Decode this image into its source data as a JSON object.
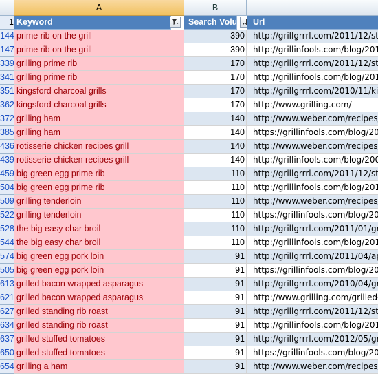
{
  "columns": [
    {
      "letter": "A",
      "selected": true
    },
    {
      "letter": "B",
      "selected": false
    }
  ],
  "header_row": {
    "number": "1",
    "keyword": "Keyword",
    "search_volume": "Search Volum",
    "url": "Url",
    "keyword_filter_icon": "filter-funnel-icon",
    "volume_sort_icon": "sort-descending-icon"
  },
  "colors": {
    "highlight_fill": "#ffc7ce",
    "highlight_text": "#9c0006",
    "header_fill": "#4f81bd",
    "band_fill": "#dce6f1",
    "selected_column_header": "#f1c15f"
  },
  "rows": [
    {
      "num": "144",
      "keyword": "prime rib on the grill",
      "volume": "390",
      "url": "http://grillgrrrl.com/2011/12/sta"
    },
    {
      "num": "147",
      "keyword": "prime rib on the grill",
      "volume": "390",
      "url": "http://grillinfools.com/blog/2010"
    },
    {
      "num": "339",
      "keyword": "grilling prime rib",
      "volume": "170",
      "url": "http://grillgrrrl.com/2011/12/sta"
    },
    {
      "num": "341",
      "keyword": "grilling prime rib",
      "volume": "170",
      "url": "http://grillinfools.com/blog/2010"
    },
    {
      "num": "351",
      "keyword": "kingsford charcoal grills",
      "volume": "170",
      "url": "http://grillgrrrl.com/2010/11/kin"
    },
    {
      "num": "362",
      "keyword": "kingsford charcoal grills",
      "volume": "170",
      "url": "http://www.grilling.com/"
    },
    {
      "num": "372",
      "keyword": "grilling ham",
      "volume": "140",
      "url": "http://www.weber.com/recipes/p"
    },
    {
      "num": "385",
      "keyword": "grilling ham",
      "volume": "140",
      "url": "https://grillinfools.com/blog/201"
    },
    {
      "num": "436",
      "keyword": "rotisserie chicken recipes grill",
      "volume": "140",
      "url": "http://www.weber.com/recipes/p"
    },
    {
      "num": "439",
      "keyword": "rotisserie chicken recipes grill",
      "volume": "140",
      "url": "http://grillinfools.com/blog/2009"
    },
    {
      "num": "459",
      "keyword": "big green egg prime rib",
      "volume": "110",
      "url": "http://grillgrrrl.com/2011/12/sta"
    },
    {
      "num": "504",
      "keyword": "big green egg prime rib",
      "volume": "110",
      "url": "http://grillinfools.com/blog/2010"
    },
    {
      "num": "509",
      "keyword": "grilling tenderloin",
      "volume": "110",
      "url": "http://www.weber.com/recipes/be"
    },
    {
      "num": "522",
      "keyword": "grilling tenderloin",
      "volume": "110",
      "url": "https://grillinfools.com/blog/201"
    },
    {
      "num": "528",
      "keyword": "the big easy char broil",
      "volume": "110",
      "url": "http://grillgrrrl.com/2011/01/gri"
    },
    {
      "num": "544",
      "keyword": "the big easy char broil",
      "volume": "110",
      "url": "http://grillinfools.com/blog/2010"
    },
    {
      "num": "574",
      "keyword": "big green egg pork loin",
      "volume": "91",
      "url": "http://grillgrrrl.com/2011/04/apr"
    },
    {
      "num": "505",
      "keyword": "big green egg pork loin",
      "volume": "91",
      "url": "https://grillinfools.com/blog/2011"
    },
    {
      "num": "613",
      "keyword": "grilled bacon wrapped asparagus",
      "volume": "91",
      "url": "http://grillgrrrl.com/2010/04/gri"
    },
    {
      "num": "621",
      "keyword": "grilled bacon wrapped asparagus",
      "volume": "91",
      "url": "http://www.grilling.com/grilled-b"
    },
    {
      "num": "627",
      "keyword": "grilled standing rib roast",
      "volume": "91",
      "url": "http://grillgrrrl.com/2011/12/sta"
    },
    {
      "num": "634",
      "keyword": "grilled standing rib roast",
      "volume": "91",
      "url": "http://grillinfools.com/blog/2010"
    },
    {
      "num": "637",
      "keyword": "grilled stuffed tomatoes",
      "volume": "91",
      "url": "http://grillgrrrl.com/2012/05/gri"
    },
    {
      "num": "650",
      "keyword": "grilled stuffed tomatoes",
      "volume": "91",
      "url": "https://grillinfools.com/blog/201"
    },
    {
      "num": "654",
      "keyword": "grilling a ham",
      "volume": "91",
      "url": "http://www.weber.com/recipes/p"
    }
  ]
}
